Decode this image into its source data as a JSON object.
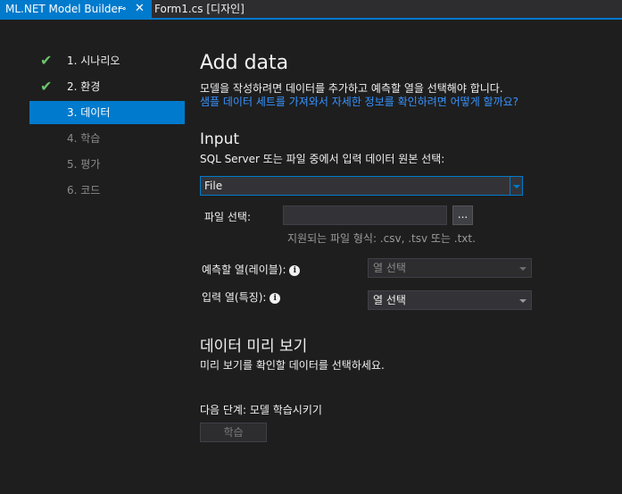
{
  "tabs": {
    "active_title": "ML.NET Model Builder",
    "pin_glyph": "⊸",
    "close_glyph": "✕",
    "second_title": "Form1.cs [디자인]"
  },
  "nav": {
    "items": [
      {
        "label": "1. 시나리오",
        "state": "done"
      },
      {
        "label": "2. 환경",
        "state": "done"
      },
      {
        "label": "3. 데이터",
        "state": "active"
      },
      {
        "label": "4. 학습",
        "state": "disabled"
      },
      {
        "label": "5. 평가",
        "state": "disabled"
      },
      {
        "label": "6. 코드",
        "state": "disabled"
      }
    ]
  },
  "main": {
    "title": "Add data",
    "description": "모델을 작성하려면 데이터를 추가하고 예측할 열을 선택해야 합니다.",
    "sample_link": "샘플 데이터 세트를 가져와서 자세한 정보를 확인하려면 어떻게 할까요?",
    "input_heading": "Input",
    "input_description": "SQL Server 또는 파일 중에서 입력 데이터 원본 선택:",
    "source_value": "File",
    "file_label": "파일 선택:",
    "file_value": "",
    "browse_label": "...",
    "file_formats": "지원되는 파일 형식: .csv, .tsv 또는 .txt.",
    "label_column_label": "예측할 열(레이블):",
    "label_column_value": "열 선택",
    "feature_column_label": "입력 열(특징):",
    "feature_column_value": "열 선택",
    "info_glyph": "i",
    "preview_heading": "데이터 미리 보기",
    "preview_description": "미리 보기를 확인할 데이터를 선택하세요.",
    "next_step": "다음 단계: 모델 학습시키기",
    "train_button": "학습"
  },
  "colors": {
    "accent": "#007acc",
    "check": "#6cc46c",
    "link": "#3794ff",
    "background": "#1e1e1e"
  }
}
